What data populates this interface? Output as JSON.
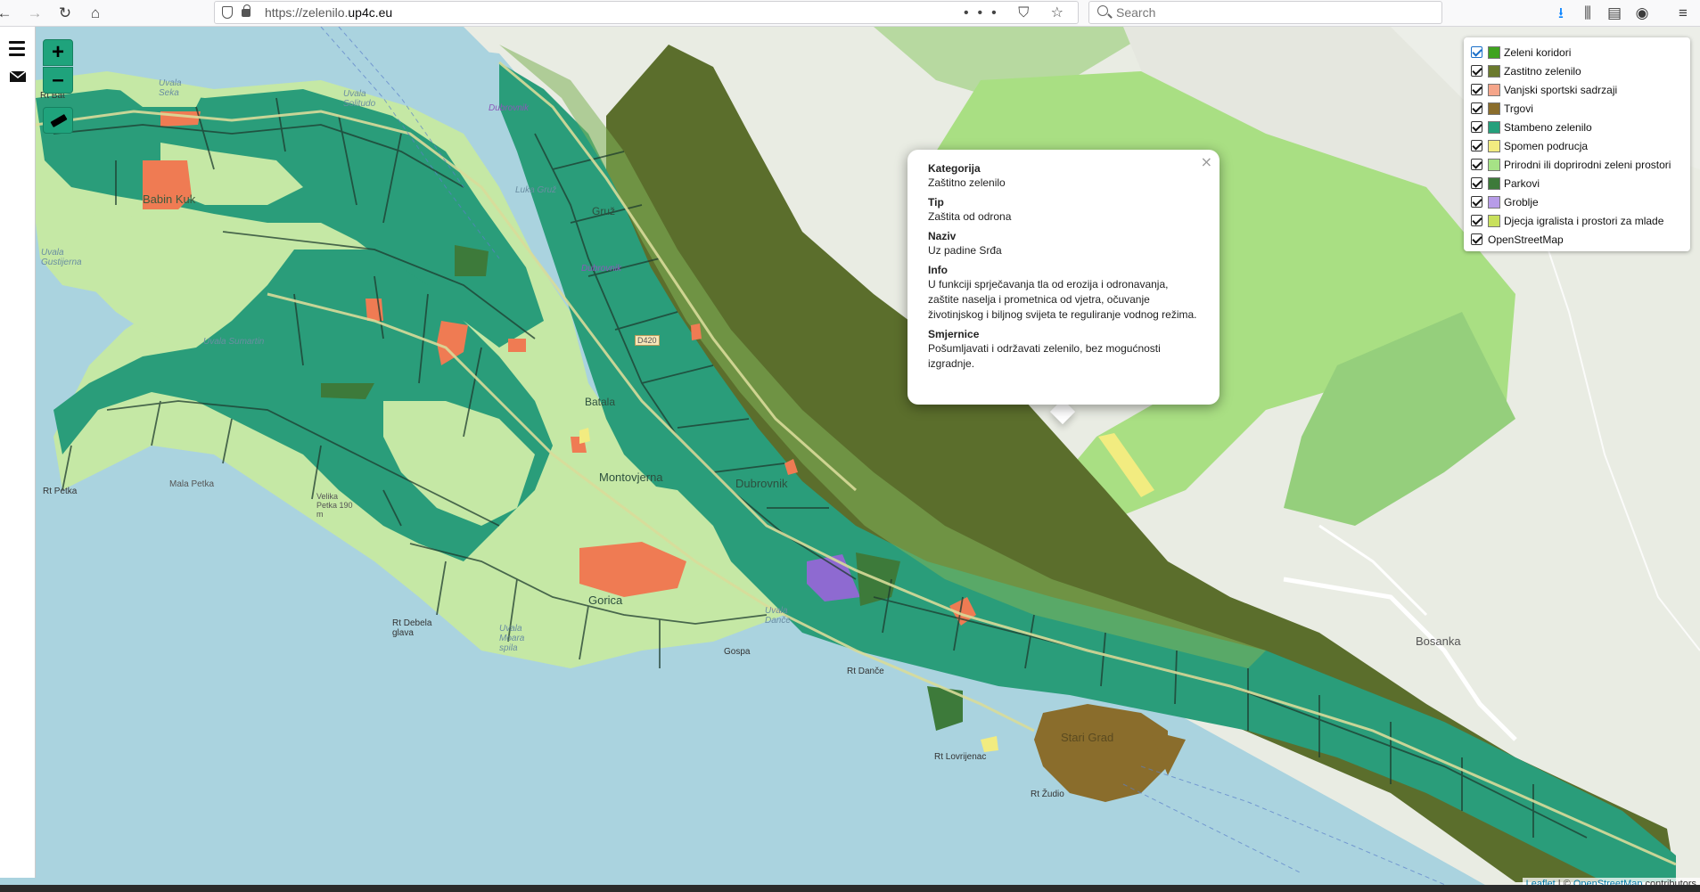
{
  "browser": {
    "url_prefix": "https://zelenilo.",
    "url_domain": "up4c.eu",
    "url_actions": "••• ⛉ ☆",
    "search_placeholder": "Search"
  },
  "controls": {
    "zoom_in": "+",
    "zoom_out": "–"
  },
  "legend": {
    "items": [
      {
        "label": "Zeleni koridori",
        "color": "#3fa31f"
      },
      {
        "label": "Zastitno zelenilo",
        "color": "#6b7a2e"
      },
      {
        "label": "Vanjski sportski sadrzaji",
        "color": "#f5a58a"
      },
      {
        "label": "Trgovi",
        "color": "#8a6d2c"
      },
      {
        "label": "Stambeno zelenilo",
        "color": "#25a07c"
      },
      {
        "label": "Spomen podrucja",
        "color": "#f2ec80"
      },
      {
        "label": "Prirodni ili doprirodni zeleni prostori",
        "color": "#a6e386"
      },
      {
        "label": "Parkovi",
        "color": "#3d7a3a"
      },
      {
        "label": "Groblje",
        "color": "#b79ce8"
      },
      {
        "label": "Djecja igralista i prostori za mlade",
        "color": "#c8e05c"
      }
    ],
    "base_layer": "OpenStreetMap"
  },
  "popup": {
    "close": "×",
    "fields": [
      {
        "heading": "Kategorija",
        "value": "Zaštitno zelenilo"
      },
      {
        "heading": "Tip",
        "value": "Zaštita od odrona"
      },
      {
        "heading": "Naziv",
        "value": "Uz padine Srđa"
      },
      {
        "heading": "Info",
        "value": "U funkciji sprječavanja tla od erozija i odronavanja, zaštite naselja i prometnica od vjetra, očuvanje životinjskog i biljnog svijeta te reguliranje vodnog režima."
      },
      {
        "heading": "Smjernice",
        "value": "Pošumljavati i održavati zelenilo, bez mogućnosti izgradnje."
      }
    ]
  },
  "map_labels": {
    "babin_kuk": "Babin Kuk",
    "uvala_sumartin": "Uvala Sumartin",
    "rt_petka": "Rt Petka",
    "mala_petka": "Mala Petka",
    "velika_petka": "Velika Petka 190 m",
    "montovjerna": "Montovjerna",
    "dubrovnik": "Dubrovnik",
    "gorica": "Gorica",
    "rt_debela_glava": "Rt Debela glava",
    "uvala_danče": "Uvala Danče",
    "rt_dance": "Rt Danče",
    "rt_lovrijenac": "Rt Lovrijenac",
    "stari_grad": "Stari Grad",
    "rt_zudio": "Rt Žudio",
    "bosanka": "Bosanka",
    "luka_gruz": "Luka Gruž",
    "uvala_lapad": "Uvala Solitudo",
    "dubrovnik_ferry": "Dubrovnik",
    "d420": "D420",
    "lapad": "Lapad",
    "batala": "Batala",
    "gruz": "Gruž",
    "uvala_seka": "Uvala Seka",
    "rt_bat": "Rt Bat",
    "gospa": "Gospa",
    "uvala_gustijerna": "Uvala Gustijerna",
    "uvala_moara": "Uvala Moara spila"
  },
  "attribution": {
    "leaflet": "Leaflet",
    "sep": " | © ",
    "osm": "OpenStreetMap",
    "contributors": " contributors"
  }
}
